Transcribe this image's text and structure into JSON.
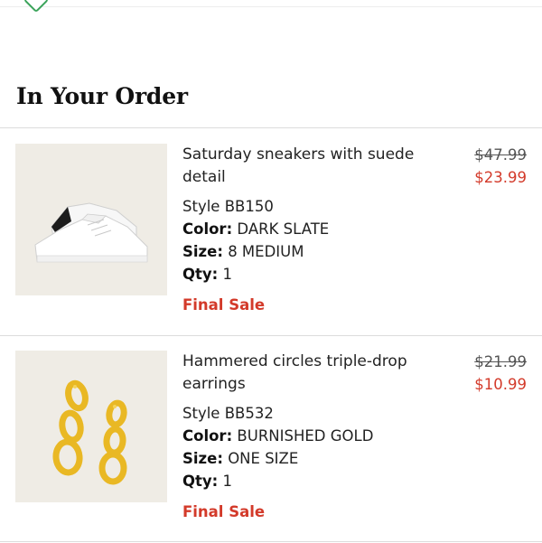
{
  "header": {
    "section_title": "In Your Order"
  },
  "items": [
    {
      "name": "Saturday sneakers with suede detail",
      "style": "Style BB150",
      "color_label": "Color:",
      "color_value": "DARK SLATE",
      "size_label": "Size:",
      "size_value": "8 MEDIUM",
      "qty_label": "Qty:",
      "qty_value": "1",
      "final_sale": "Final Sale",
      "original_price": "$47.99",
      "sale_price": "$23.99"
    },
    {
      "name": "Hammered circles triple-drop earrings",
      "style": "Style BB532",
      "color_label": "Color:",
      "color_value": "BURNISHED GOLD",
      "size_label": "Size:",
      "size_value": "ONE SIZE",
      "qty_label": "Qty:",
      "qty_value": "1",
      "final_sale": "Final Sale",
      "original_price": "$21.99",
      "sale_price": "$10.99"
    }
  ],
  "colors": {
    "sale_red": "#d33a2a",
    "thumb_bg": "#efece5",
    "accent_green": "#3aa35a"
  }
}
